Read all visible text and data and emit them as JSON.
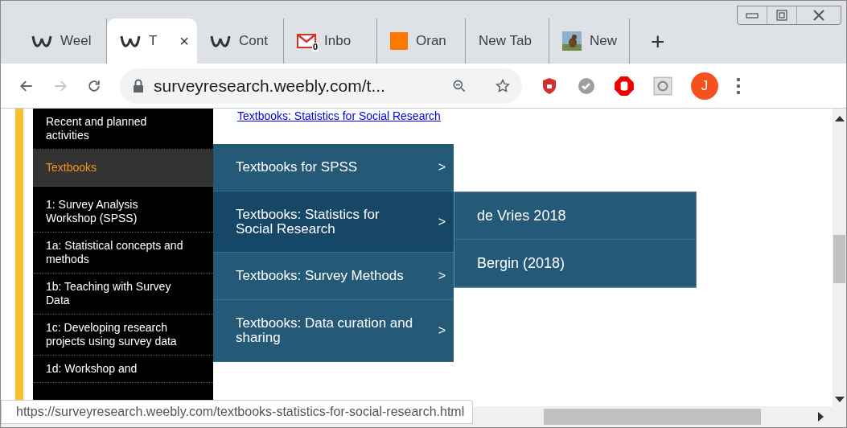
{
  "tabs": [
    {
      "label": "Weel",
      "kind": "weebly",
      "selected": false
    },
    {
      "label": "T",
      "kind": "weebly",
      "selected": true,
      "close": "×"
    },
    {
      "label": "Cont",
      "kind": "weebly",
      "selected": false
    },
    {
      "label": "Inbo",
      "kind": "mail",
      "badge": "0",
      "selected": false
    },
    {
      "label": "Oran",
      "kind": "square",
      "selected": false
    },
    {
      "label": "New Tab",
      "kind": "plain",
      "selected": false
    },
    {
      "label": "New",
      "kind": "picture",
      "selected": false
    }
  ],
  "new_tab": "+",
  "toolbar": {
    "forward_disabled": true,
    "url": "surveyresearch.weebly.com/t...",
    "avatar": "J"
  },
  "page": {
    "top_link": "Textbooks: Statistics for Social Research",
    "sidebar": [
      {
        "label": "Recent and planned activities",
        "selected": false
      },
      {
        "label": "Textbooks",
        "selected": true
      },
      {
        "label": "1: Survey Analysis Workshop (SPSS)",
        "selected": false
      },
      {
        "label": "1a: Statistical concepts and methods",
        "selected": false
      },
      {
        "label": "1b: Teaching with Survey Data",
        "selected": false
      },
      {
        "label": "1c: Developing research projects using survey data",
        "selected": false
      },
      {
        "label": "1d: Workshop and",
        "selected": false
      }
    ],
    "menu": [
      {
        "label": "Textbooks for SPSS",
        "arrow": ">",
        "selected": false
      },
      {
        "label": "Textbooks: Statistics for Social Research",
        "arrow": ">",
        "selected": true
      },
      {
        "label": "Textbooks: Survey Methods",
        "arrow": ">",
        "selected": false
      },
      {
        "label": "Textbooks: Data curation and sharing",
        "arrow": ">",
        "selected": false
      }
    ],
    "submenu": [
      {
        "label": "de Vries 2018"
      },
      {
        "label": "Bergin (2018)"
      }
    ]
  },
  "status_url": "https://surveyresearch.weebly.com/textbooks-statistics-for-social-research.html"
}
